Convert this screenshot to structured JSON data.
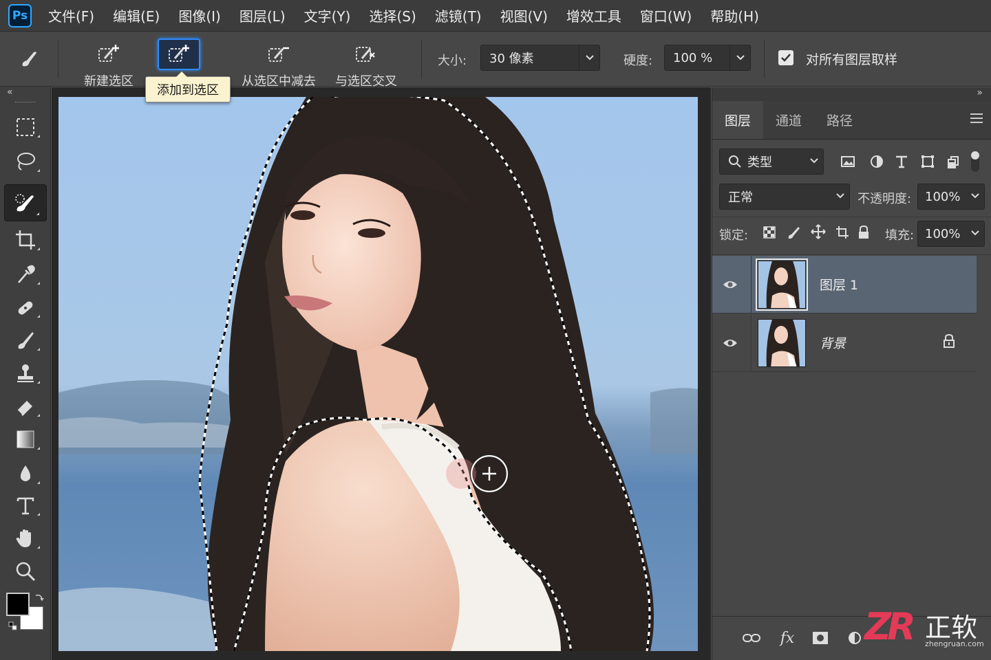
{
  "app": {
    "logo": "Ps"
  },
  "menu": [
    "文件(F)",
    "编辑(E)",
    "图像(I)",
    "图层(L)",
    "文字(Y)",
    "选择(S)",
    "滤镜(T)",
    "视图(V)",
    "增效工具",
    "窗口(W)",
    "帮助(H)"
  ],
  "options": {
    "modes": [
      {
        "label": "新建选区",
        "icon": "new-selection-icon"
      },
      {
        "label": "",
        "icon": "add-to-selection-icon"
      },
      {
        "label": "从选区中减去",
        "icon": "subtract-selection-icon"
      },
      {
        "label": "与选区交叉",
        "icon": "intersect-selection-icon"
      }
    ],
    "tooltip": "添加到选区",
    "size_label": "大小:",
    "size_value": "30 像素",
    "hardness_label": "硬度:",
    "hardness_value": "100 %",
    "sample_all_label": "对所有图层取样",
    "sample_all_checked": true
  },
  "toolbar": {
    "collapse": "«",
    "tools": [
      "rectangular-marquee-icon",
      "lasso-icon",
      "quick-selection-icon",
      "crop-icon",
      "eyedropper-icon",
      "healing-brush-icon",
      "brush-icon",
      "clone-stamp-icon",
      "eraser-icon",
      "gradient-icon",
      "blur-icon",
      "type-icon",
      "hand-icon",
      "zoom-icon"
    ],
    "active_tool": "quick-selection-icon",
    "foreground_color": "#000000",
    "background_color": "#ffffff"
  },
  "panel": {
    "expand": "»",
    "tabs": [
      "图层",
      "通道",
      "路径"
    ],
    "filter_label": "类型",
    "blend_mode": "正常",
    "opacity_label": "不透明度:",
    "opacity_value": "100%",
    "lock_label": "锁定:",
    "fill_label": "填充:",
    "fill_value": "100%",
    "layers": [
      {
        "name": "图层 1",
        "selected": true,
        "locked": false
      },
      {
        "name": "背景",
        "selected": false,
        "locked": true
      }
    ]
  },
  "watermark": {
    "mark": "ZR",
    "text": "正软",
    "url": "zhengruan.com"
  }
}
